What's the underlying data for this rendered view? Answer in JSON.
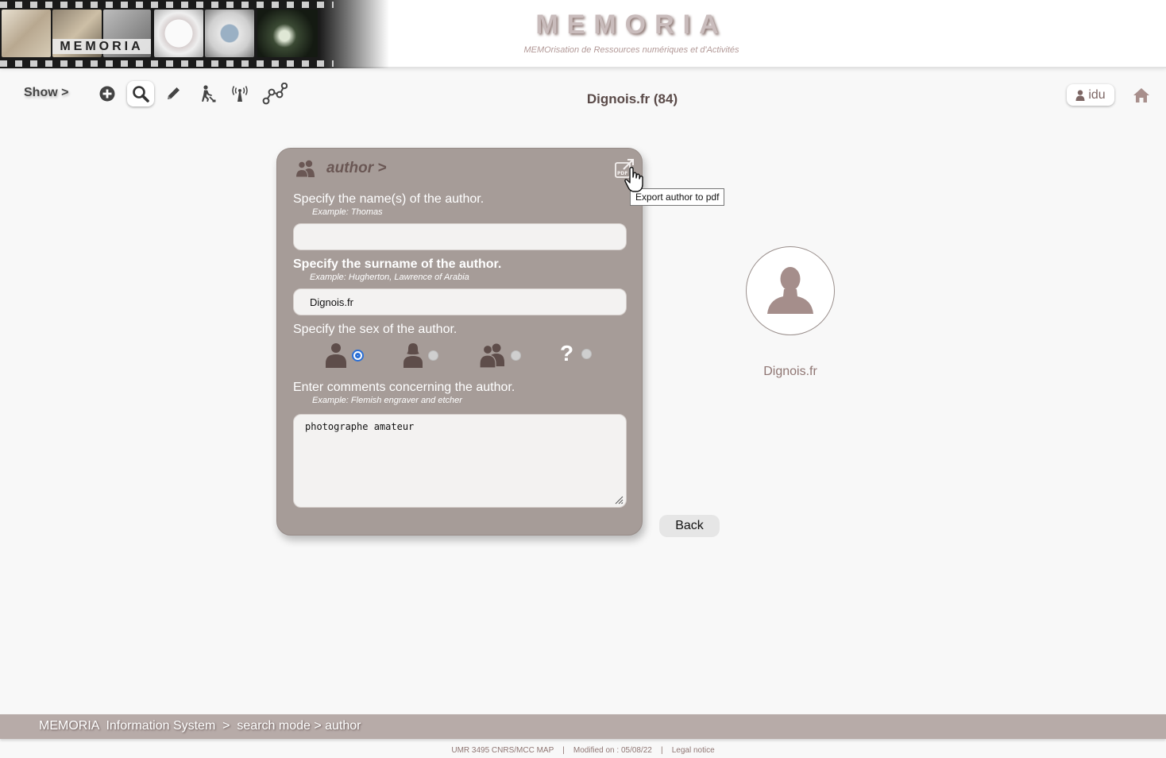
{
  "banner": {
    "film_logo": "MEMORIA",
    "title": "MEMORIA",
    "subtitle": "MEMOrisation de Ressources numériques et d'Activités"
  },
  "toolbar": {
    "show_label": "Show >",
    "page_heading": "Dignois.fr (84)",
    "user_label": "idu",
    "icons": [
      "add-icon",
      "search-icon",
      "edit-pencil-icon",
      "work-icon",
      "antenna-icon",
      "network-graph-icon",
      "home-icon"
    ]
  },
  "form": {
    "title": "author >",
    "export_tooltip": "Export author to pdf",
    "name_label": "Specify the name(s) of the author.",
    "name_example": "Example: Thomas",
    "name_value": "",
    "surname_label": "Specify the surname of the author.",
    "surname_example": "Example: Hugherton, Lawrence of Arabia",
    "surname_value": "Dignois.fr",
    "sex_label": "Specify the sex of the author.",
    "sex_options": [
      "male",
      "female",
      "group",
      "unknown"
    ],
    "sex_selected": "male",
    "unknown_symbol": "?",
    "comments_label": "Enter comments concerning the author.",
    "comments_example": "Example: Flemish engraver and etcher",
    "comments_value": "photographe amateur"
  },
  "profile": {
    "name": "Dignois.fr"
  },
  "actions": {
    "back_label": "Back"
  },
  "footer": {
    "crumb_system": "MEMORIA  Information System",
    "crumb_sep": "  >  ",
    "crumb_mode": "search mode > author",
    "lab": "UMR 3495 CNRS/MCC MAP",
    "sep": "    |    ",
    "modified": "Modified on : 05/08/22",
    "legal": "Legal notice"
  },
  "colors": {
    "panel": "#a69c98",
    "accent_text": "#6a5754",
    "footer_bar": "#b7aba8",
    "radio_selected": "#2a6fd6"
  }
}
